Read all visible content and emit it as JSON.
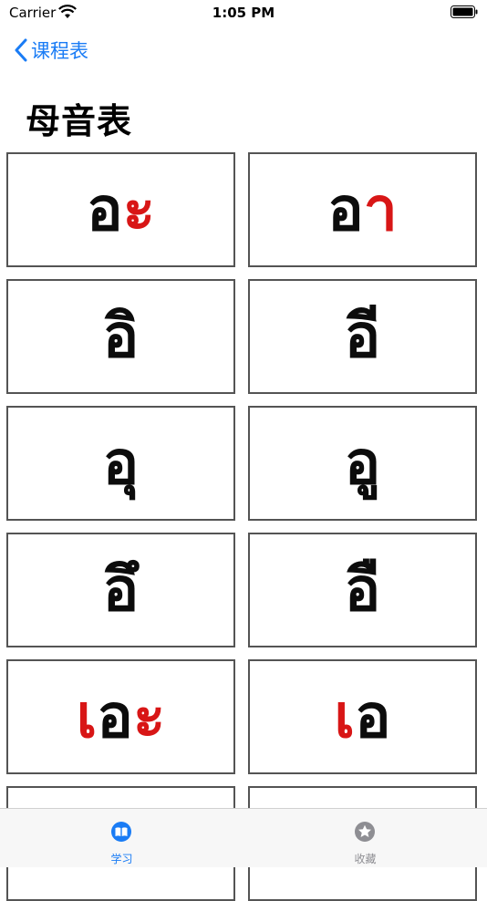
{
  "status_bar": {
    "carrier": "Carrier",
    "time": "1:05 PM"
  },
  "nav": {
    "back_label": "课程表"
  },
  "page_title": "母音表",
  "vowels": [
    {
      "black": "อ",
      "red": "ะ"
    },
    {
      "black": "อ",
      "red": "า"
    },
    {
      "black": "อิ",
      "red": ""
    },
    {
      "black": "อี",
      "red": ""
    },
    {
      "black": "อุ",
      "red": ""
    },
    {
      "black": "อู",
      "red": ""
    },
    {
      "black": "อึ",
      "red": ""
    },
    {
      "black": "อื",
      "red": ""
    },
    {
      "red_prefix": "เ",
      "black": "อ",
      "red": "ะ"
    },
    {
      "red_prefix": "เ",
      "black": "อ",
      "red": ""
    }
  ],
  "tabs": [
    {
      "label": "学习",
      "icon": "book-icon",
      "active": true
    },
    {
      "label": "收藏",
      "icon": "star-icon",
      "active": false
    }
  ],
  "colors": {
    "accent": "#1a7cf5",
    "vowel_mark": "#d81616",
    "border": "#545454"
  }
}
